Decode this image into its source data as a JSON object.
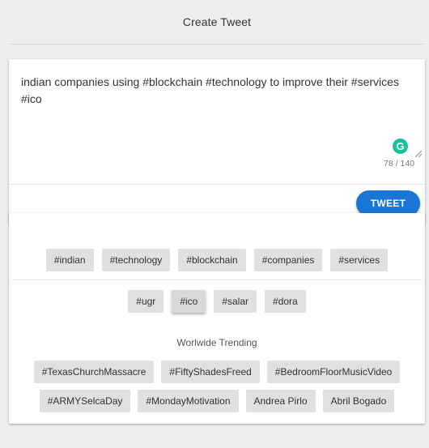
{
  "header": {
    "title": "Create Tweet"
  },
  "compose": {
    "text": "indian companies using #blockchain #technology to improve their #services\n#ico",
    "counter": "78 / 140",
    "grammarly_letter": "G",
    "tweet_label": "TWEET",
    "accent_color": "#1976d2"
  },
  "suggested_tags": {
    "row1": [
      "#indian",
      "#technology",
      "#blockchain",
      "#companies",
      "#services"
    ],
    "row2": [
      "#ugr",
      "#ico",
      "#salar",
      "#dora"
    ]
  },
  "trending": {
    "title": "Worlwide Trending",
    "row1": [
      "#TexasChurchMassacre",
      "#FiftyShadesFreed",
      "#BedroomFloorMusicVideo"
    ],
    "row2": [
      "#ARMYSelcaDay",
      "#MondayMotivation",
      "Andrea Pirlo",
      "Abril Bogado"
    ]
  }
}
